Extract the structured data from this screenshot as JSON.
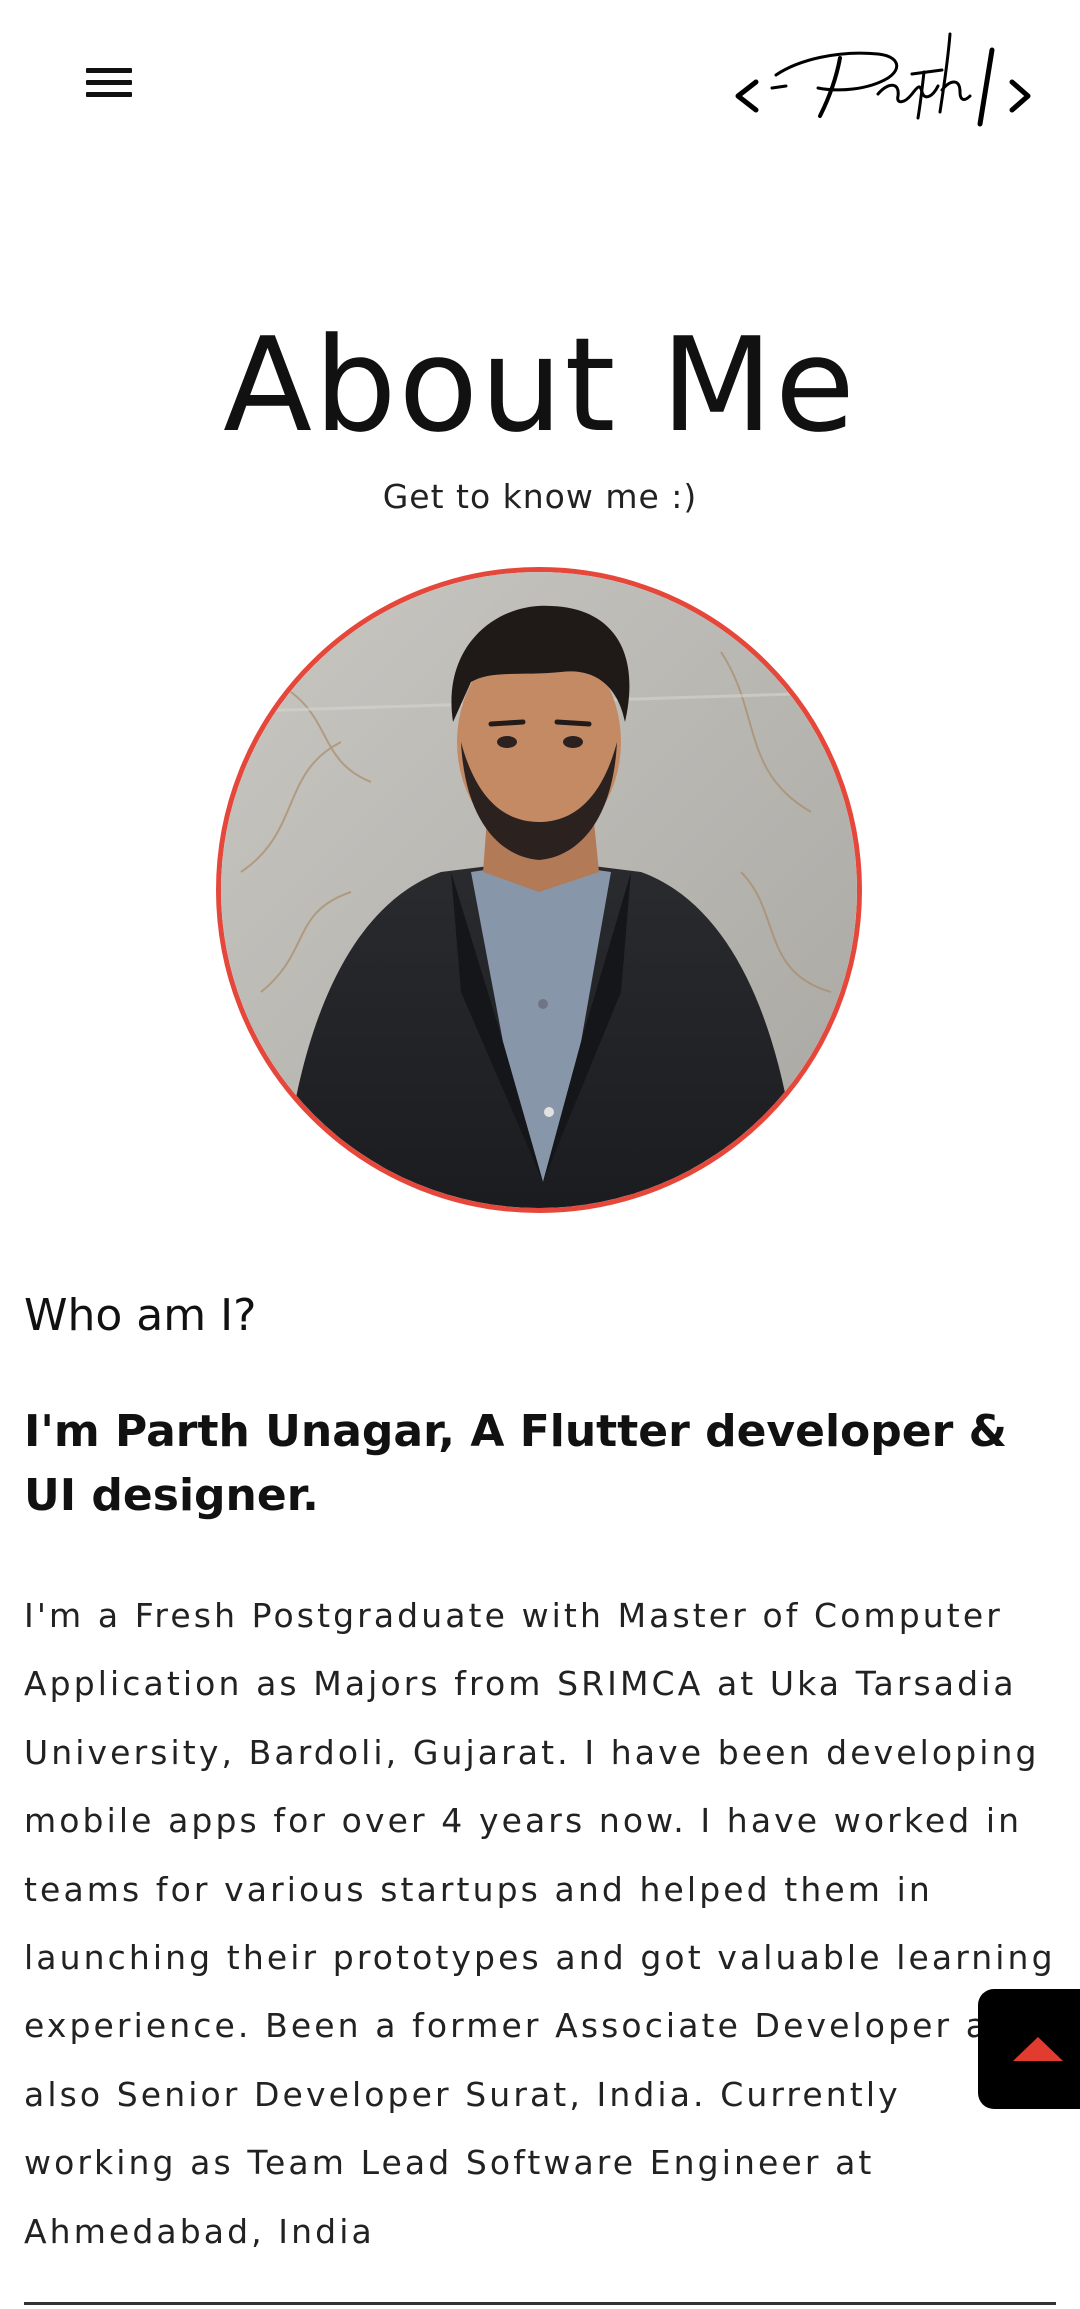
{
  "header": {
    "menu_icon": "hamburger-menu-icon",
    "logo_text": "< Parth />"
  },
  "page": {
    "title": "About Me",
    "subtitle": "Get to know me :)"
  },
  "profile": {
    "photo_border_color": "#e5483b"
  },
  "about": {
    "who_heading": "Who am I?",
    "intro": "I'm Parth Unagar, A Flutter developer & UI designer.",
    "bio": "I'm a Fresh Postgraduate with Master of Computer Application as Majors from SRIMCA at Uka Tarsadia University, Bardoli, Gujarat. I have been developing mobile apps for over 4 years now. I have worked in teams for various startups and helped them in launching their prototypes and got valuable learning experience. Been a former Associate Developer and also Senior Developer Surat, India. Currently working as Team Lead Software Engineer at Ahmedabad, India"
  },
  "scroll_top": {
    "icon": "arrow-up-icon",
    "accent": "#e23c31"
  }
}
